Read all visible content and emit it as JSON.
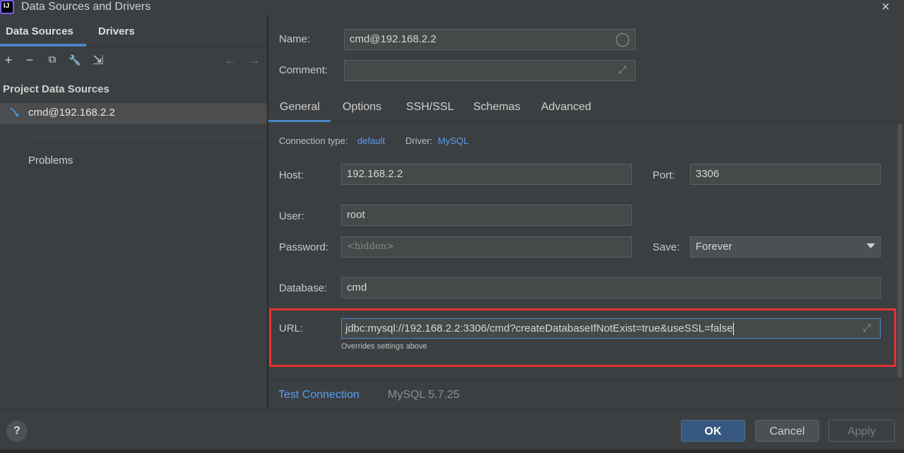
{
  "window": {
    "title": "Data Sources and Drivers",
    "close_icon": "×"
  },
  "left": {
    "tabs": [
      {
        "label": "Data Sources"
      },
      {
        "label": "Drivers"
      }
    ],
    "toolbar": {
      "add": "+",
      "remove": "−",
      "copy": "⧉",
      "wrench": "🔧",
      "import": "⇲",
      "back": "←",
      "forward": "→"
    },
    "section_title": "Project Data Sources",
    "items": [
      {
        "label": "cmd@192.168.2.2"
      }
    ],
    "problems_label": "Problems"
  },
  "right": {
    "name_label": "Name:",
    "name_value": "cmd@192.168.2.2",
    "comment_label": "Comment:",
    "comment_value": "",
    "tabs": [
      {
        "label": "General"
      },
      {
        "label": "Options"
      },
      {
        "label": "SSH/SSL"
      },
      {
        "label": "Schemas"
      },
      {
        "label": "Advanced"
      }
    ],
    "conn_type_label": "Connection type:",
    "conn_type_value": "default",
    "driver_label": "Driver:",
    "driver_value": "MySQL",
    "host_label": "Host:",
    "host_value": "192.168.2.2",
    "port_label": "Port:",
    "port_value": "3306",
    "user_label": "User:",
    "user_value": "root",
    "password_label": "Password:",
    "password_placeholder": "<hidden>",
    "save_label": "Save:",
    "save_value": "Forever",
    "database_label": "Database:",
    "database_value": "cmd",
    "url_label": "URL:",
    "url_value": "jdbc:mysql://192.168.2.2:3306/cmd?createDatabaseIfNotExist=true&useSSL=false",
    "url_hint": "Overrides settings above",
    "test_connection": "Test Connection",
    "server_version": "MySQL 5.7.25"
  },
  "footer": {
    "help": "?",
    "ok": "OK",
    "cancel": "Cancel",
    "apply": "Apply"
  },
  "colors": {
    "accent": "#4a88c7",
    "highlight_border": "#e53333",
    "link": "#589df6"
  }
}
